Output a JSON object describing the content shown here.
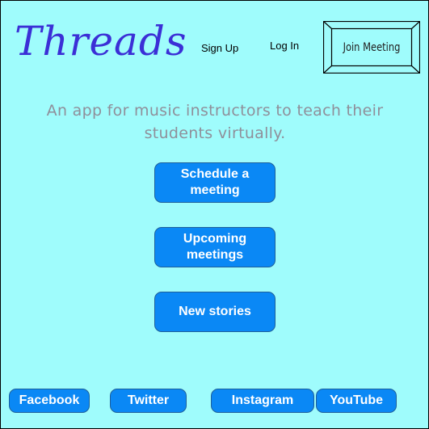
{
  "header": {
    "logo_text": "Threads",
    "nav": {
      "sign_up": "Sign Up",
      "log_in": "Log In"
    },
    "join_meeting_label": "Join Meeting"
  },
  "main": {
    "tagline_line1": "An app for music instructors to teach their",
    "tagline_line2": "students virtually.",
    "buttons": {
      "schedule_line1": "Schedule a",
      "schedule_line2": "meeting",
      "upcoming_line1": "Upcoming",
      "upcoming_line2": "meetings",
      "new_stories": "New stories"
    }
  },
  "footer": {
    "social": [
      "Facebook",
      "Twitter",
      "Instagram",
      "YouTube"
    ]
  },
  "colors": {
    "background": "#9ffcfc",
    "logo": "#3b2fd6",
    "button": "#0a88f5",
    "tagline": "#8f8f9a"
  }
}
